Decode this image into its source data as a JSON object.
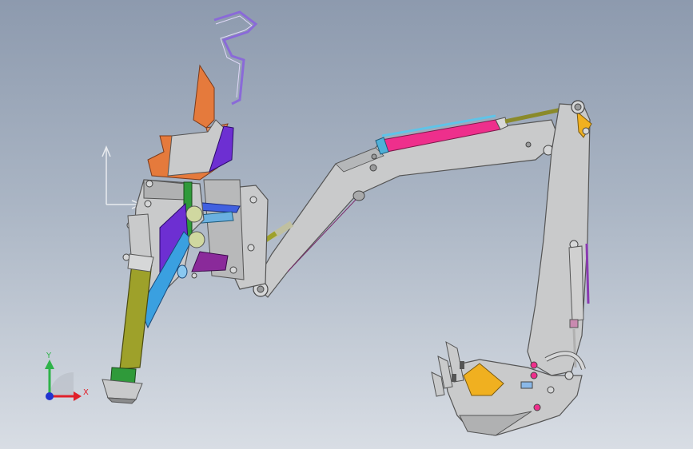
{
  "viewport": {
    "background_top": "#8d9aae",
    "background_bottom": "#d8dde4"
  },
  "triad": {
    "x_label": "X",
    "y_label": "Y",
    "x_color": "#e0202a",
    "y_color": "#2fb34a",
    "z_color": "#2034d0"
  },
  "colors": {
    "arm_gray": "#c9cacb",
    "seat_orange": "#e57a3c",
    "cylinder_magenta": "#ee2f8c",
    "cylinder_cyan": "#5fc4e8",
    "leg_olive": "#9ea12a",
    "frame_purple": "#6d2fd2",
    "frame_blue": "#3aa0e0",
    "bucket_gold": "#f0b020",
    "rod_olive": "#8a8a2a"
  },
  "icons": [
    "triad-icon",
    "reference-axes-icon"
  ]
}
